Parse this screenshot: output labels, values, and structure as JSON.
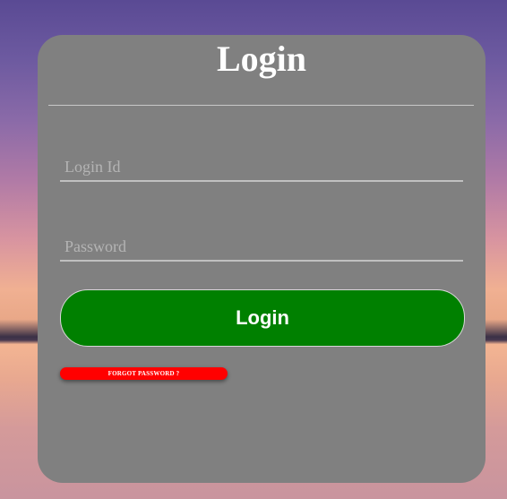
{
  "login_card": {
    "title": "Login",
    "login_id_placeholder": "Login Id",
    "password_placeholder": "Password",
    "login_button_label": "Login",
    "forgot_password_label": "FORGOT PASSWORD ?"
  },
  "colors": {
    "card_background": "#808080",
    "login_button": "#008000",
    "forgot_button": "#ff0000",
    "text": "#ffffff"
  }
}
